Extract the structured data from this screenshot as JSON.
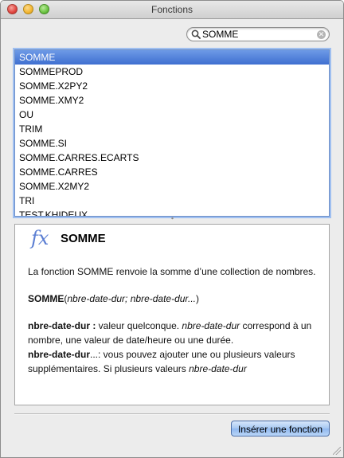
{
  "window": {
    "title": "Fonctions"
  },
  "search": {
    "value": "SOMME",
    "icon": "magnifier-icon",
    "clear_icon": "clear-icon"
  },
  "function_list": {
    "items": [
      "SOMME",
      "SOMMEPROD",
      "SOMME.X2PY2",
      "SOMME.XMY2",
      "OU",
      "TRIM",
      "SOMME.SI",
      "SOMME.CARRES.ECARTS",
      "SOMME.CARRES",
      "SOMME.X2MY2",
      "TRI",
      "TEST.KHIDEUX"
    ],
    "selected_index": 0,
    "selection_color": "#3f6fd0"
  },
  "description": {
    "icon_glyph": "fx",
    "name": "SOMME",
    "summary": "La fonction SOMME renvoie la somme d’une collection de nombres.",
    "syntax_name": "SOMME",
    "syntax_open": "(",
    "syntax_args": "nbre-date-dur; nbre-date-dur...",
    "syntax_close": ")",
    "arg1_name": "nbre-date-dur :",
    "arg1_text_a": "  valeur quelconque. ",
    "arg1_text_italic": "nbre-date-dur",
    "arg1_text_b": " correspond à un nombre, une valeur de date/heure ou une durée.",
    "arg2_name": "nbre-date-dur",
    "arg2_name_suffix": "...:",
    "arg2_text_a": "  vous pouvez ajouter une ou plusieurs valeurs supplémentaires. Si plusieurs valeurs ",
    "arg2_text_italic": "nbre-date-dur"
  },
  "footer": {
    "insert_label": "Insérer une fonction",
    "accent_color": "#8fb7ee"
  }
}
